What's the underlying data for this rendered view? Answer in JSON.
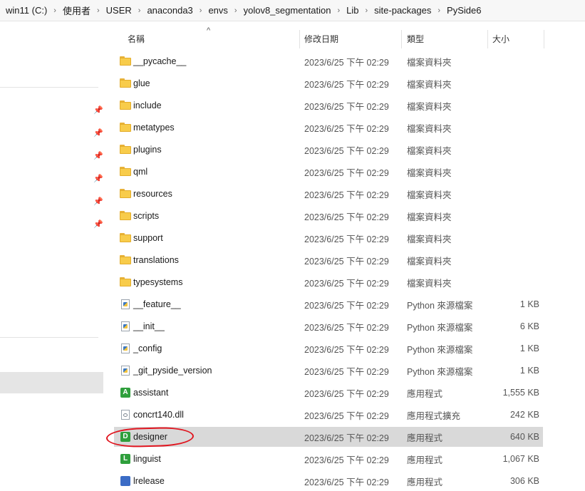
{
  "breadcrumb": [
    "win11 (C:)",
    "使用者",
    "USER",
    "anaconda3",
    "envs",
    "yolov8_segmentation",
    "Lib",
    "site-packages",
    "PySide6"
  ],
  "columns": {
    "name": "名稱",
    "date": "修改日期",
    "type": "類型",
    "size": "大小"
  },
  "sort_indicator": "^",
  "pin_glyph": "📌",
  "rows": [
    {
      "name": "__pycache__",
      "date": "2023/6/25 下午 02:29",
      "type": "檔案資料夾",
      "size": "",
      "icon": "folder-icon"
    },
    {
      "name": "glue",
      "date": "2023/6/25 下午 02:29",
      "type": "檔案資料夾",
      "size": "",
      "icon": "folder-icon"
    },
    {
      "name": "include",
      "date": "2023/6/25 下午 02:29",
      "type": "檔案資料夾",
      "size": "",
      "icon": "folder-icon"
    },
    {
      "name": "metatypes",
      "date": "2023/6/25 下午 02:29",
      "type": "檔案資料夾",
      "size": "",
      "icon": "folder-icon"
    },
    {
      "name": "plugins",
      "date": "2023/6/25 下午 02:29",
      "type": "檔案資料夾",
      "size": "",
      "icon": "folder-icon"
    },
    {
      "name": "qml",
      "date": "2023/6/25 下午 02:29",
      "type": "檔案資料夾",
      "size": "",
      "icon": "folder-icon"
    },
    {
      "name": "resources",
      "date": "2023/6/25 下午 02:29",
      "type": "檔案資料夾",
      "size": "",
      "icon": "folder-icon"
    },
    {
      "name": "scripts",
      "date": "2023/6/25 下午 02:29",
      "type": "檔案資料夾",
      "size": "",
      "icon": "folder-icon"
    },
    {
      "name": "support",
      "date": "2023/6/25 下午 02:29",
      "type": "檔案資料夾",
      "size": "",
      "icon": "folder-icon"
    },
    {
      "name": "translations",
      "date": "2023/6/25 下午 02:29",
      "type": "檔案資料夾",
      "size": "",
      "icon": "folder-icon"
    },
    {
      "name": "typesystems",
      "date": "2023/6/25 下午 02:29",
      "type": "檔案資料夾",
      "size": "",
      "icon": "folder-icon"
    },
    {
      "name": "__feature__",
      "date": "2023/6/25 下午 02:29",
      "type": "Python 來源檔案",
      "size": "1 KB",
      "icon": "python-file-icon"
    },
    {
      "name": "__init__",
      "date": "2023/6/25 下午 02:29",
      "type": "Python 來源檔案",
      "size": "6 KB",
      "icon": "python-file-icon"
    },
    {
      "name": "_config",
      "date": "2023/6/25 下午 02:29",
      "type": "Python 來源檔案",
      "size": "1 KB",
      "icon": "python-file-icon"
    },
    {
      "name": "_git_pyside_version",
      "date": "2023/6/25 下午 02:29",
      "type": "Python 來源檔案",
      "size": "1 KB",
      "icon": "python-file-icon"
    },
    {
      "name": "assistant",
      "date": "2023/6/25 下午 02:29",
      "type": "應用程式",
      "size": "1,555 KB",
      "icon": "assistant-app-icon",
      "glyph": "A"
    },
    {
      "name": "concrt140.dll",
      "date": "2023/6/25 下午 02:29",
      "type": "應用程式擴充",
      "size": "242 KB",
      "icon": "dll-file-icon"
    },
    {
      "name": "designer",
      "date": "2023/6/25 下午 02:29",
      "type": "應用程式",
      "size": "640 KB",
      "icon": "designer-app-icon",
      "glyph": "D",
      "selected": true
    },
    {
      "name": "linguist",
      "date": "2023/6/25 下午 02:29",
      "type": "應用程式",
      "size": "1,067 KB",
      "icon": "linguist-app-icon",
      "glyph": "L"
    },
    {
      "name": "lrelease",
      "date": "2023/6/25 下午 02:29",
      "type": "應用程式",
      "size": "306 KB",
      "icon": "lrelease-app-icon"
    }
  ],
  "colors": {
    "folder": "#f8cc4b",
    "selection": "#d9d9d9",
    "annotation": "#e0151f",
    "qt_green": "#2f9f3c"
  }
}
